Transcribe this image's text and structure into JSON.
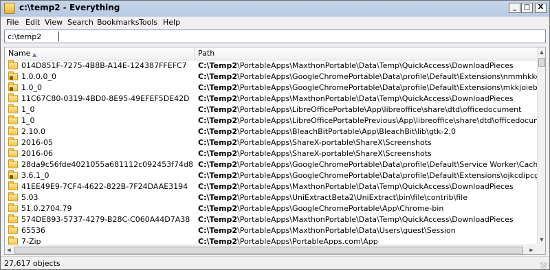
{
  "window": {
    "title": "c:\\temp2 - Everything"
  },
  "controls": {
    "minimize": "_",
    "maximize": "□",
    "close": "X"
  },
  "menu": [
    "File",
    "Edit",
    "View",
    "Search",
    "Bookmarks",
    "Tools",
    "Help"
  ],
  "search": {
    "value": "c:\\temp2"
  },
  "columns": {
    "name": "Name",
    "path": "Path"
  },
  "rows": [
    {
      "name": "014D851F-7275-4B8B-A14E-124387FFEFC7",
      "root": "C:\\Temp2",
      "rest": "\\PortableApps\\MaxthonPortable\\Data\\Temp\\QuickAccess\\DownloadPieces",
      "locked": false
    },
    {
      "name": "1.0.0.0_0",
      "root": "C:\\Temp2",
      "rest": "\\PortableApps\\GoogleChromePortable\\Data\\profile\\Default\\Extensions\\nmmhkkegccagdldgiimedp",
      "locked": true
    },
    {
      "name": "1.0_0",
      "root": "C:\\Temp2",
      "rest": "\\PortableApps\\GoogleChromePortable\\Data\\profile\\Default\\Extensions\\mkkjoiebiampndpmidmadl",
      "locked": true
    },
    {
      "name": "11C67C80-0319-4BD0-8E95-49EFEF5DE42D",
      "root": "C:\\Temp2",
      "rest": "\\PortableApps\\MaxthonPortable\\Data\\Temp\\QuickAccess\\DownloadPieces",
      "locked": false
    },
    {
      "name": "1_0",
      "root": "C:\\Temp2",
      "rest": "\\PortableApps\\LibreOfficePortable\\App\\libreoffice\\share\\dtd\\officedocument",
      "locked": false
    },
    {
      "name": "1_0",
      "root": "C:\\Temp2",
      "rest": "\\PortableApps\\LibreOfficePortablePrevious\\App\\libreoffice\\share\\dtd\\officedocument",
      "locked": false
    },
    {
      "name": "2.10.0",
      "root": "C:\\Temp2",
      "rest": "\\PortableApps\\BleachBitPortable\\App\\BleachBit\\lib\\gtk-2.0",
      "locked": false
    },
    {
      "name": "2016-05",
      "root": "C:\\Temp2",
      "rest": "\\PortableApps\\ShareX-portable\\ShareX\\Screenshots",
      "locked": false
    },
    {
      "name": "2016-06",
      "root": "C:\\Temp2",
      "rest": "\\PortableApps\\ShareX-portable\\ShareX\\Screenshots",
      "locked": false
    },
    {
      "name": "28da9c56fde4021055a681112c092453f74d8dd8",
      "root": "C:\\Temp2",
      "rest": "\\PortableApps\\GoogleChromePortable\\Data\\profile\\Default\\Service Worker\\CacheStorage",
      "locked": false
    },
    {
      "name": "3.6.1_0",
      "root": "C:\\Temp2",
      "rest": "\\PortableApps\\GoogleChromePortable\\Data\\profile\\Default\\Extensions\\ojkcdipcgfaekbeaelaapak",
      "locked": true
    },
    {
      "name": "41EE49E9-7CF4-4622-822B-7F24DAAE3194",
      "root": "C:\\Temp2",
      "rest": "\\PortableApps\\MaxthonPortable\\Data\\Temp\\QuickAccess\\DownloadPieces",
      "locked": false
    },
    {
      "name": "5.03",
      "root": "C:\\Temp2",
      "rest": "\\PortableApps\\UniExtractBeta2\\UniExtract\\bin\\file\\contrib\\file",
      "locked": false
    },
    {
      "name": "51.0.2704.79",
      "root": "C:\\Temp2",
      "rest": "\\PortableApps\\GoogleChromePortable\\App\\Chrome-bin",
      "locked": false
    },
    {
      "name": "574DE893-5737-4279-B28C-C060A44D7A38",
      "root": "C:\\Temp2",
      "rest": "\\PortableApps\\MaxthonPortable\\Data\\Temp\\QuickAccess\\DownloadPieces",
      "locked": false
    },
    {
      "name": "65536",
      "root": "C:\\Temp2",
      "rest": "\\PortableApps\\MaxthonPortable\\Data\\Users\\guest\\Session",
      "locked": false
    },
    {
      "name": "7-Zip",
      "root": "C:\\Temp2",
      "rest": "\\PortableApps\\PortableApps.com\\App",
      "locked": false
    }
  ],
  "status": {
    "text": "27,617 objects"
  }
}
